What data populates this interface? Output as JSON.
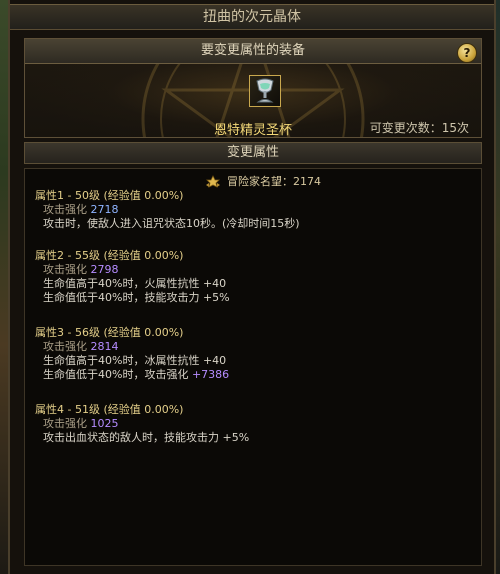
{
  "window": {
    "title": "扭曲的次元晶体"
  },
  "equip_panel": {
    "header": "要变更属性的装备",
    "help_label": "?",
    "item_name": "恩特精灵圣杯",
    "change_count_label": "可变更次数：15次"
  },
  "attr_section": {
    "header": "变更属性",
    "reputation_label": "冒险家名望：2174"
  },
  "attributes": [
    {
      "title": "属性1 - 50级 (经验值 0.00%)",
      "strength_label": "攻击强化",
      "strength_value": "2718",
      "effects": [
        "攻击时，使敌人进入诅咒状态10秒。(冷却时间15秒)"
      ]
    },
    {
      "title": "属性2 - 55级 (经验值 0.00%)",
      "strength_label": "攻击强化",
      "strength_value": "2798",
      "effects": [
        "生命值高于40%时，火属性抗性 +40",
        "生命值低于40%时，技能攻击力 +5%"
      ]
    },
    {
      "title": "属性3 - 56级 (经验值 0.00%)",
      "strength_label": "攻击强化",
      "strength_value": "2814",
      "effects": [
        "生命值高于40%时，冰属性抗性 +40"
      ],
      "effect_low_prefix": "生命值低于40%时，攻击强化",
      "effect_low_value": "+7386"
    },
    {
      "title": "属性4 - 51级 (经验值 0.00%)",
      "strength_label": "攻击强化",
      "strength_value": "1025",
      "effects": [
        "攻击出血状态的敌人时，技能攻击力 +5%"
      ]
    }
  ],
  "colors": {
    "gold_text": "#e4cf8a",
    "item_name": "#f2d777",
    "value_blue": "#8fb4ff",
    "value_purple": "#b58cff"
  },
  "icons": {
    "help": "question-mark-icon",
    "item": "grail-cup-icon",
    "reputation": "reputation-emblem-icon"
  }
}
